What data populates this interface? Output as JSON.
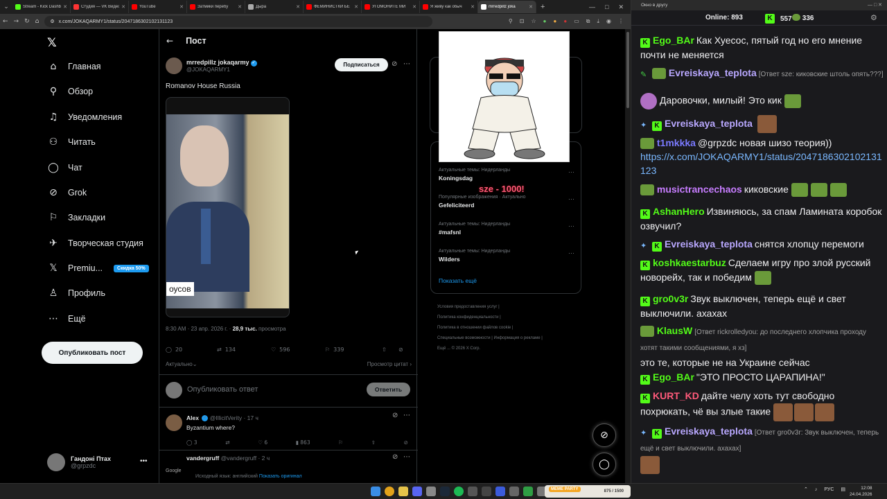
{
  "browser": {
    "tabs": [
      {
        "title": "Stream - Kick Dashb",
        "color": "#53fc18"
      },
      {
        "title": "Студия — VK Видео",
        "color": "#ff3333"
      },
      {
        "title": "YouTube",
        "color": "#ff0000"
      },
      {
        "title": "Затмики перебу",
        "color": "#ff0000"
      },
      {
        "title": "Дыра",
        "color": "#aaaaaa"
      },
      {
        "title": "ФЕМИНИСТКИ БЕ",
        "color": "#ff0000"
      },
      {
        "title": "УГОМОНИТЕ МИ",
        "color": "#ff0000"
      },
      {
        "title": "Я живу как обыч",
        "color": "#ff0000"
      },
      {
        "title": "mrredpillz joka",
        "color": "#ffffff",
        "active": true
      }
    ],
    "url": "x.com/JOKAQARMY1/status/2047186302102131123"
  },
  "leftnav": {
    "items": [
      {
        "label": "Главная",
        "icon": "⌂"
      },
      {
        "label": "Обзор",
        "icon": "⚲"
      },
      {
        "label": "Уведомления",
        "icon": "♫"
      },
      {
        "label": "Читать",
        "icon": "⚇"
      },
      {
        "label": "Чат",
        "icon": "◯"
      },
      {
        "label": "Grok",
        "icon": "⊘"
      },
      {
        "label": "Закладки",
        "icon": "⚐"
      },
      {
        "label": "Творческая студия",
        "icon": "✈"
      },
      {
        "label": "Premiu...",
        "icon": "𝕏"
      },
      {
        "label": "Профиль",
        "icon": "♙"
      },
      {
        "label": "Ещё",
        "icon": "⋯"
      }
    ],
    "premium_badge": "Скидка 50%",
    "post_button": "Опубликовать пост",
    "account": {
      "name": "Гандоні Птах",
      "handle": "@grpzdc"
    }
  },
  "main": {
    "header_title": "Пост",
    "author": {
      "name": "mrredpillz jokaqarmy",
      "handle": "@JOKAQARMY1"
    },
    "follow_label": "Подписаться",
    "post_text": "Romanov House Russia",
    "media_caption": "оусов",
    "meta": {
      "time": "8:30 AM · 23 апр. 2026 г. ·",
      "views": "28,9 тыс.",
      "views_label": "просмотра"
    },
    "actions": {
      "replies": "20",
      "reposts": "134",
      "likes": "596",
      "bookmarks": "339"
    },
    "sort_label": "Актуально",
    "quotes_label": "Просмотр цитат",
    "reply_placeholder": "Опубликовать ответ",
    "reply_button": "Ответить",
    "reply1": {
      "name": "Alex",
      "handle": "@IllicitVerity · 17 ч",
      "text": "Byzantium where?",
      "replies": "3",
      "likes": "6",
      "views": "863"
    },
    "reply2": {
      "name": "vandergruff",
      "handle": "@vandergruff · 2 ч",
      "logo": "Google",
      "source": "Исходный язык: английский",
      "link": "Показать оригинал"
    }
  },
  "right": {
    "trends": [
      {
        "category": "Актуальные темы: Нидерланды",
        "name": "Koningsdag"
      },
      {
        "category": "Популярные изображения · Актуально",
        "name": "Gefeliciteerd"
      },
      {
        "category": "Актуальные темы: Нидерланды",
        "name": "#mafsnl"
      },
      {
        "category": "Актуальные темы: Нидерланды",
        "name": "Wilders"
      }
    ],
    "show_more": "Показать ещё",
    "footer": [
      "Условия предоставления услуг",
      "Политика конфиденциальности",
      "Политика в отношении файлов cookie",
      "Специальные возможности",
      "Информация о рекламе",
      "Ещё ...",
      "© 2026 X Corp."
    ]
  },
  "overlay": {
    "donation": "sze - 1000!"
  },
  "chat": {
    "window_title": "Окно в другу",
    "online_label": "Online:",
    "online_count": "893",
    "viewers2": "557",
    "viewers3": "336",
    "messages": [
      {
        "user": "Ego_BAr",
        "color": "#53fc18",
        "text": "Как Хуесос, пятый год но его мнение почти не меняется"
      },
      {
        "user": "Evreiskaya_teplota",
        "color": "#b9a8ff",
        "reply": "[Ответ sze: киковские штоль опять???]",
        "text": ""
      },
      {
        "user": "",
        "color": "#efeff1",
        "text": "Даровочки, милый! Это кик"
      },
      {
        "user": "Evreiskaya_teplota",
        "color": "#b9a8ff",
        "text": ""
      },
      {
        "user": "t1mkkka",
        "color": "#7a7aff",
        "text": "@grpzdc новая шизо теория))",
        "link": "https://x.com/JOKAQARMY1/status/2047186302102131123"
      },
      {
        "user": "musictrancechaos",
        "color": "#c77dff",
        "text": "киковские"
      },
      {
        "user": "AshanHero",
        "color": "#53fc18",
        "text": "Извиняюсь, за спам Ламината коробок озвучил?"
      },
      {
        "user": "Evreiskaya_teplota",
        "color": "#b9a8ff",
        "text": "снятся хлопцу перемоги"
      },
      {
        "user": "koshkaestarbuz",
        "color": "#53fc18",
        "text": "Сделаем игру про злой русский новорейх, так и победим"
      },
      {
        "user": "gro0v3r",
        "color": "#53fc18",
        "text": "Звук выключен, теперь ещё и свет выключили. ахахах"
      },
      {
        "user": "KlausW",
        "color": "#53fc18",
        "reply": "[Ответ rickrolledyou: до последнего хлопчика проходу хотят такими сообщениями, я хз]",
        "text": "это те, которые не на Украине сейчас"
      },
      {
        "user": "Ego_BAr",
        "color": "#53fc18",
        "text": "\"ЭТО ПРОСТО ЦАРАПИНА!\""
      },
      {
        "user": "KURT_KD",
        "color": "#ff5a7a",
        "text": "дайте челу хоть тут свободно похрюкать, чё вы злые такие"
      },
      {
        "user": "Evreiskaya_teplota",
        "color": "#b9a8ff",
        "reply": "[Ответ gro0v3r: Звук выключен, теперь ещё и свет выключили. ахахах]",
        "text": ""
      }
    ]
  },
  "taskbar": {
    "widget": "875 / 1500",
    "widget_brand": "MEME PARTY",
    "lang": "РУС",
    "time": "12:08",
    "date": "24.04.2026"
  }
}
